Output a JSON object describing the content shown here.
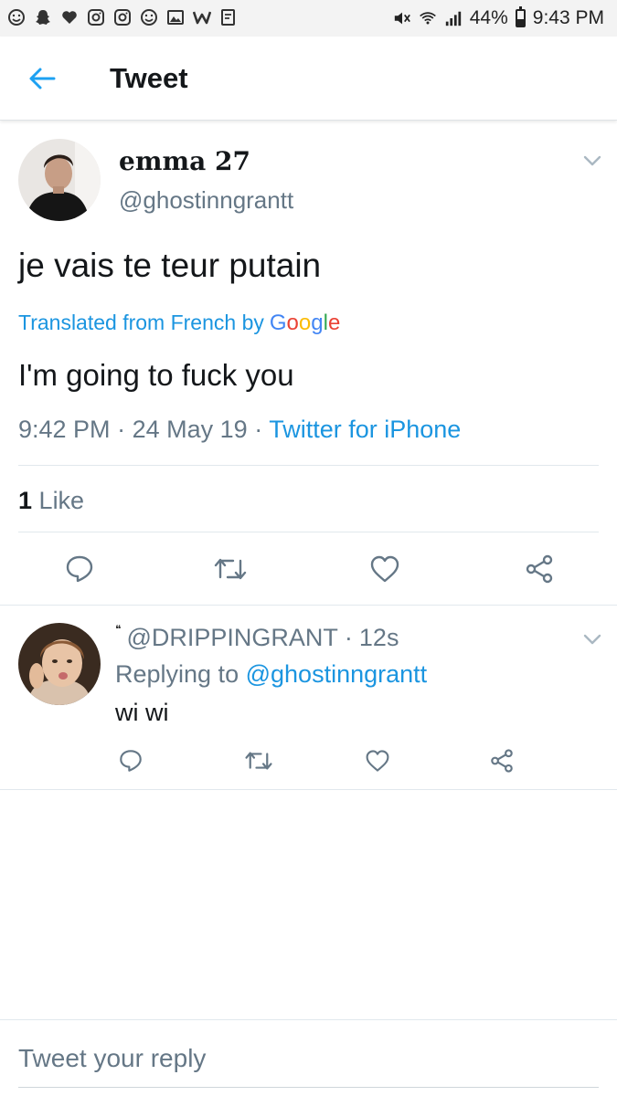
{
  "status_bar": {
    "left_icons": [
      "smile-icon",
      "snapchat-icon",
      "heart-icon",
      "instagram-icon",
      "instagram-icon",
      "smile-icon",
      "gallery-icon",
      "w-icon",
      "tx-icon"
    ],
    "battery_percent": "44%",
    "battery_level": 0.44,
    "time": "9:43 PM"
  },
  "header": {
    "back_icon": "back-arrow-icon",
    "title": "Tweet"
  },
  "main_tweet": {
    "display_name": "emma 27",
    "handle": "@ghostinngrantt",
    "text": "je vais te teur putain",
    "translated_label": "Translated from French by",
    "translator_brand": "Google",
    "translation": "I'm going to fuck you",
    "time": "9:42 PM",
    "separator": "·",
    "date": "24 May 19",
    "source": "Twitter for iPhone",
    "like_count": "1",
    "like_label": "Like"
  },
  "reply": {
    "handle": "@DRIPPINGRANT",
    "separator": "·",
    "age": "12s",
    "replying_label": "Replying to",
    "replying_to": "@ghostinngrantt",
    "text": "wi wi"
  },
  "compose": {
    "placeholder": "Tweet your reply"
  },
  "colors": {
    "link_blue": "#1b95e0",
    "back_arrow": "#1da1f2",
    "secondary_text": "#657786",
    "primary_text": "#14171a",
    "divider": "#e1e8ed"
  }
}
